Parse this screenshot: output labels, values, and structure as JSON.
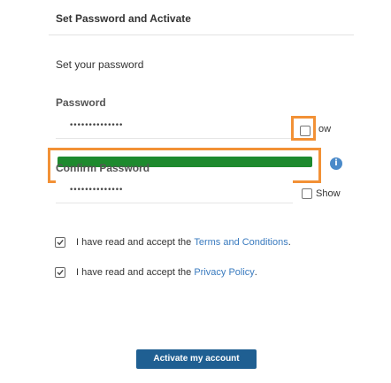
{
  "header": {
    "title": "Set Password and Activate"
  },
  "form": {
    "subtitle": "Set your password",
    "password": {
      "label": "Password",
      "value_masked": "••••••••••••••",
      "show_label_partial": "ow",
      "strength_fraction": 1.0,
      "strength_color": "#1e8a2e"
    },
    "confirm_password": {
      "label": "Confirm Password",
      "value_masked": "••••••••••••••",
      "show_label": "Show"
    },
    "terms": {
      "prefix": "I have read and accept the ",
      "link": "Terms and Conditions",
      "suffix": ".",
      "checked": true
    },
    "privacy": {
      "prefix": "I have read and accept the ",
      "link": "Privacy Policy",
      "suffix": ".",
      "checked": true
    },
    "submit_label": "Activate my account"
  },
  "icons": {
    "info": "info-icon",
    "checkbox": "checkbox-icon",
    "checkmark": "checkmark-icon"
  },
  "colors": {
    "highlight": "#f29136",
    "button": "#1f5f92",
    "link": "#3a7bbf",
    "info": "#4a8ac9"
  }
}
